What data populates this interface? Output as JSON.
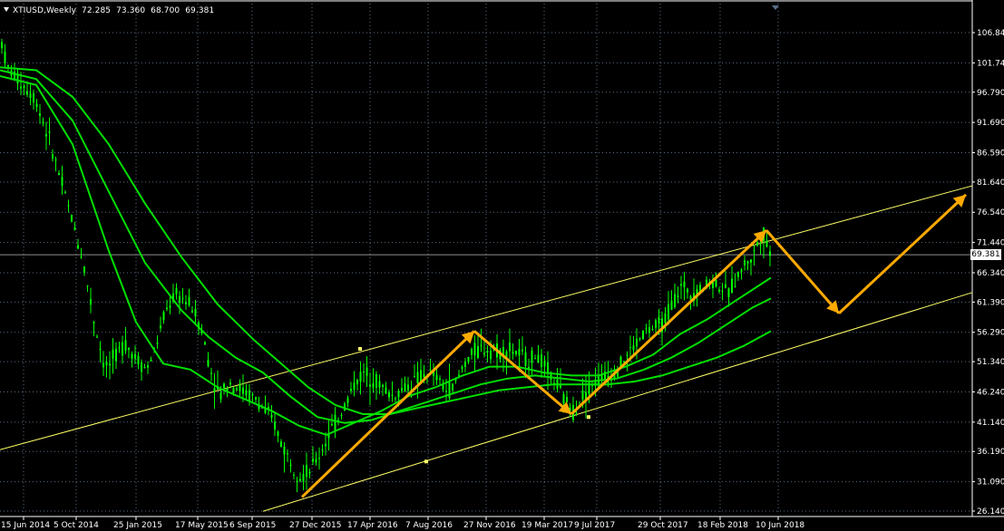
{
  "header": {
    "symbol": "XTIUSD,Weekly",
    "open": "72.285",
    "high": "73.360",
    "low": "68.700",
    "close": "69.381"
  },
  "current_price_label": "69.381",
  "colors": {
    "background": "#000000",
    "grid": "#5a6e85",
    "candles": "#00ff00",
    "moving_averages": "#00e000",
    "channel": "#ffff66",
    "arrows": "#ffaa00",
    "axis_text": "#ffffff"
  },
  "chart_data": {
    "type": "candlestick",
    "symbol": "XTIUSD",
    "timeframe": "Weekly",
    "y_ticks": [
      106.84,
      101.74,
      96.79,
      91.69,
      86.59,
      81.64,
      76.54,
      71.44,
      66.34,
      61.39,
      56.29,
      51.34,
      46.24,
      41.14,
      36.19,
      31.09,
      26.14
    ],
    "y_tick_labels": [
      "106.840",
      "101.740",
      "96.790",
      "91.690",
      "86.590",
      "81.640",
      "76.540",
      "71.440",
      "66.340",
      "61.390",
      "56.290",
      "51.340",
      "46.240",
      "41.140",
      "36.190",
      "31.090",
      "26.140"
    ],
    "x_tick_labels": [
      "15 Jun 2014",
      "5 Oct 2014",
      "25 Jan 2015",
      "17 May 2015",
      "6 Sep 2015",
      "27 Dec 2015",
      "17 Apr 2016",
      "7 Aug 2016",
      "27 Nov 2016",
      "19 Mar 2017",
      "9 Jul 2017",
      "29 Oct 2017",
      "18 Feb 2018",
      "10 Jun 2018"
    ],
    "price_path": [
      [
        0,
        106.5
      ],
      [
        8,
        101.0
      ],
      [
        22,
        98.5
      ],
      [
        38,
        96.0
      ],
      [
        52,
        90.0
      ],
      [
        66,
        82.5
      ],
      [
        80,
        75.0
      ],
      [
        92,
        68.0
      ],
      [
        104,
        58.0
      ],
      [
        116,
        50.0
      ],
      [
        126,
        52.0
      ],
      [
        138,
        54.5
      ],
      [
        150,
        52.0
      ],
      [
        162,
        50.0
      ],
      [
        172,
        54.0
      ],
      [
        182,
        59.5
      ],
      [
        192,
        62.5
      ],
      [
        202,
        62.0
      ],
      [
        212,
        60.5
      ],
      [
        222,
        57.0
      ],
      [
        232,
        50.0
      ],
      [
        242,
        45.5
      ],
      [
        252,
        48.0
      ],
      [
        262,
        47.0
      ],
      [
        272,
        46.0
      ],
      [
        282,
        45.0
      ],
      [
        292,
        43.0
      ],
      [
        302,
        41.0
      ],
      [
        312,
        37.0
      ],
      [
        322,
        34.0
      ],
      [
        332,
        32.0
      ],
      [
        342,
        33.0
      ],
      [
        352,
        35.5
      ],
      [
        362,
        39.0
      ],
      [
        372,
        41.5
      ],
      [
        382,
        44.5
      ],
      [
        392,
        48.0
      ],
      [
        402,
        49.5
      ],
      [
        412,
        48.5
      ],
      [
        422,
        47.0
      ],
      [
        432,
        45.5
      ],
      [
        442,
        46.5
      ],
      [
        452,
        47.5
      ],
      [
        462,
        48.5
      ],
      [
        472,
        49.5
      ],
      [
        482,
        48.5
      ],
      [
        492,
        46.5
      ],
      [
        502,
        47.5
      ],
      [
        512,
        51.0
      ],
      [
        522,
        53.0
      ],
      [
        532,
        53.5
      ],
      [
        542,
        53.5
      ],
      [
        552,
        53.0
      ],
      [
        562,
        53.5
      ],
      [
        572,
        52.5
      ],
      [
        582,
        51.5
      ],
      [
        592,
        52.5
      ],
      [
        602,
        50.0
      ],
      [
        612,
        48.0
      ],
      [
        622,
        45.0
      ],
      [
        632,
        43.0
      ],
      [
        642,
        45.5
      ],
      [
        652,
        47.5
      ],
      [
        662,
        48.5
      ],
      [
        672,
        49.0
      ],
      [
        682,
        50.5
      ],
      [
        692,
        52.5
      ],
      [
        702,
        54.5
      ],
      [
        712,
        56.5
      ],
      [
        722,
        57.0
      ],
      [
        732,
        58.0
      ],
      [
        742,
        61.5
      ],
      [
        752,
        64.0
      ],
      [
        762,
        63.0
      ],
      [
        772,
        63.5
      ],
      [
        782,
        65.0
      ],
      [
        792,
        64.5
      ],
      [
        802,
        62.5
      ],
      [
        812,
        65.5
      ],
      [
        822,
        68.0
      ],
      [
        830,
        69.0
      ],
      [
        836,
        71.5
      ],
      [
        842,
        73.0
      ],
      [
        847,
        70.0
      ],
      [
        850,
        69.4
      ]
    ],
    "moving_averages": [
      {
        "points": [
          [
            0,
            99.5
          ],
          [
            40,
            98.0
          ],
          [
            80,
            88.0
          ],
          [
            120,
            70.0
          ],
          [
            150,
            58.0
          ],
          [
            180,
            51.0
          ],
          [
            210,
            50.0
          ],
          [
            240,
            47.0
          ],
          [
            270,
            45.0
          ],
          [
            300,
            43.0
          ],
          [
            330,
            40.5
          ],
          [
            360,
            39.0
          ],
          [
            390,
            41.0
          ],
          [
            420,
            43.0
          ],
          [
            450,
            45.5
          ],
          [
            480,
            47.0
          ],
          [
            510,
            49.0
          ],
          [
            540,
            50.5
          ],
          [
            570,
            50.5
          ],
          [
            600,
            49.5
          ],
          [
            630,
            49.0
          ],
          [
            660,
            49.0
          ],
          [
            690,
            50.5
          ],
          [
            720,
            52.5
          ],
          [
            750,
            56.0
          ],
          [
            780,
            58.5
          ],
          [
            810,
            61.5
          ],
          [
            840,
            64.5
          ],
          [
            850,
            65.5
          ]
        ]
      },
      {
        "points": [
          [
            0,
            100.5
          ],
          [
            40,
            99.0
          ],
          [
            80,
            92.0
          ],
          [
            120,
            80.0
          ],
          [
            160,
            68.0
          ],
          [
            200,
            60.0
          ],
          [
            230,
            55.5
          ],
          [
            260,
            52.0
          ],
          [
            290,
            49.5
          ],
          [
            320,
            45.5
          ],
          [
            350,
            42.0
          ],
          [
            380,
            41.0
          ],
          [
            410,
            41.5
          ],
          [
            440,
            43.0
          ],
          [
            470,
            44.5
          ],
          [
            500,
            46.0
          ],
          [
            530,
            47.5
          ],
          [
            560,
            48.5
          ],
          [
            590,
            49.0
          ],
          [
            620,
            48.5
          ],
          [
            650,
            48.0
          ],
          [
            680,
            48.5
          ],
          [
            710,
            50.0
          ],
          [
            740,
            52.0
          ],
          [
            770,
            54.5
          ],
          [
            800,
            57.5
          ],
          [
            830,
            60.5
          ],
          [
            850,
            62.0
          ]
        ]
      },
      {
        "points": [
          [
            0,
            101.0
          ],
          [
            40,
            100.5
          ],
          [
            80,
            96.0
          ],
          [
            120,
            88.0
          ],
          [
            160,
            78.0
          ],
          [
            200,
            69.0
          ],
          [
            240,
            61.0
          ],
          [
            280,
            55.0
          ],
          [
            310,
            51.0
          ],
          [
            340,
            47.0
          ],
          [
            370,
            44.0
          ],
          [
            400,
            42.5
          ],
          [
            430,
            42.5
          ],
          [
            460,
            43.5
          ],
          [
            490,
            44.5
          ],
          [
            520,
            45.5
          ],
          [
            550,
            46.5
          ],
          [
            580,
            47.0
          ],
          [
            610,
            47.5
          ],
          [
            640,
            47.5
          ],
          [
            670,
            47.5
          ],
          [
            700,
            48.0
          ],
          [
            730,
            49.0
          ],
          [
            760,
            50.5
          ],
          [
            790,
            52.0
          ],
          [
            820,
            54.0
          ],
          [
            850,
            56.5
          ]
        ]
      }
    ],
    "channel": {
      "upper": [
        [
          0,
          36.5
        ],
        [
          1072,
          81.0
        ]
      ],
      "lower": [
        [
          290,
          26.1
        ],
        [
          1072,
          63.0
        ]
      ],
      "upper_anchor": [
        397,
        53.5
      ],
      "lower_anchors": [
        [
          470,
          34.5
        ],
        [
          649,
          42.0
        ]
      ]
    },
    "projection_arrows": [
      [
        [
          333,
          28.5
        ],
        [
          523,
          56.5
        ]
      ],
      [
        [
          523,
          56.5
        ],
        [
          630,
          42.5
        ]
      ],
      [
        [
          630,
          42.5
        ],
        [
          845,
          73.5
        ]
      ],
      [
        [
          845,
          73.5
        ],
        [
          925,
          59.5
        ]
      ],
      [
        [
          925,
          59.5
        ],
        [
          1065,
          79.5
        ]
      ]
    ]
  }
}
